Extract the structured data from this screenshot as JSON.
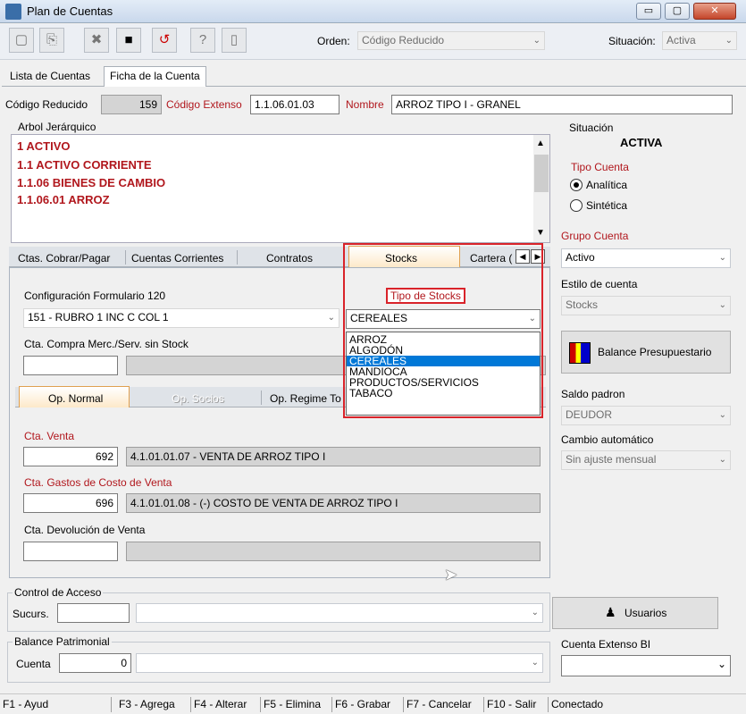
{
  "window": {
    "title": "Plan de Cuentas",
    "minimize": "▭",
    "maximize": "▢",
    "close": "✕"
  },
  "toolbar": {
    "icons": [
      "new-icon",
      "copy-icon",
      "delete-icon",
      "save-icon",
      "undo-icon",
      "help-icon",
      "exit-icon"
    ],
    "orden_label": "Orden:",
    "orden_value": "Código Reducido",
    "situacion_label": "Situación:",
    "situacion_value": "Activa"
  },
  "main_tabs": [
    "Lista de Cuentas",
    "Ficha de la Cuenta"
  ],
  "header": {
    "codigo_reducido_label": "Código Reducido",
    "codigo_reducido_value": "159",
    "codigo_extenso_label": "Código Extenso",
    "codigo_extenso_value": "1.1.06.01.03",
    "nombre_label": "Nombre",
    "nombre_value": "ARROZ TIPO I - GRANEL"
  },
  "arbol": {
    "label": "Arbol Jerárquico",
    "items": [
      "1  ACTIVO",
      "1.1  ACTIVO CORRIENTE",
      "1.1.06  BIENES DE CAMBIO",
      "1.1.06.01  ARROZ"
    ]
  },
  "right": {
    "situacion_label": "Situación",
    "situacion_value": "ACTIVA",
    "tipo_cuenta_label": "Tipo Cuenta",
    "analitica": "Analítica",
    "sintetica": "Sintética",
    "grupo_cuenta_label": "Grupo Cuenta",
    "grupo_cuenta_value": "Activo",
    "estilo_label": "Estilo de cuenta",
    "estilo_value": "Stocks",
    "balance_button": "Balance Presupuestario",
    "saldo_label": "Saldo padron",
    "saldo_value": "DEUDOR",
    "cambio_label": "Cambio automático",
    "cambio_value": "Sin ajuste mensual"
  },
  "sub_tabs": [
    "Ctas. Cobrar/Pagar",
    "Cuentas Corrientes",
    "Contratos",
    "Stocks",
    "Cartera ("
  ],
  "stocks": {
    "config_label": "Configuración Formulario 120",
    "config_value": "151 - RUBRO 1 INC C COL 1",
    "tipo_label": "Tipo de Stocks",
    "tipo_value": "CEREALES",
    "tipo_options": [
      "ARROZ",
      "ALGODÓN",
      "CEREALES",
      "MANDIOCA",
      "PRODUCTOS/SERVICIOS",
      "TABACO"
    ],
    "compra_label": "Cta. Compra Merc./Serv. sin Stock"
  },
  "op_tabs": [
    "Op. Normal",
    "Op. Socios",
    "Op. Regime To"
  ],
  "op": {
    "venta_label": "Cta. Venta",
    "venta_code": "692",
    "venta_desc": "4.1.01.01.07 - VENTA DE ARROZ TIPO I",
    "gastos_label": "Cta. Gastos de Costo de Venta",
    "gastos_code": "696",
    "gastos_desc": "4.1.01.01.08 - (-) COSTO DE VENTA DE ARROZ TIPO I",
    "devolucion_label": "Cta. Devolución de Venta"
  },
  "acceso": {
    "label": "Control de Acceso",
    "sucurs_label": "Sucurs.",
    "usuarios_button": "Usuarios"
  },
  "balance": {
    "label": "Balance Patrimonial",
    "cuenta_label": "Cuenta",
    "cuenta_value": "0",
    "extenso_label": "Cuenta Extenso BI"
  },
  "status": [
    "F1 - Ayud",
    "F3 - Agrega",
    "F4 - Alterar",
    "F5 - Elimina",
    "F6 - Grabar",
    "F7 - Cancelar",
    "F10 - Salir",
    "Conectado"
  ]
}
